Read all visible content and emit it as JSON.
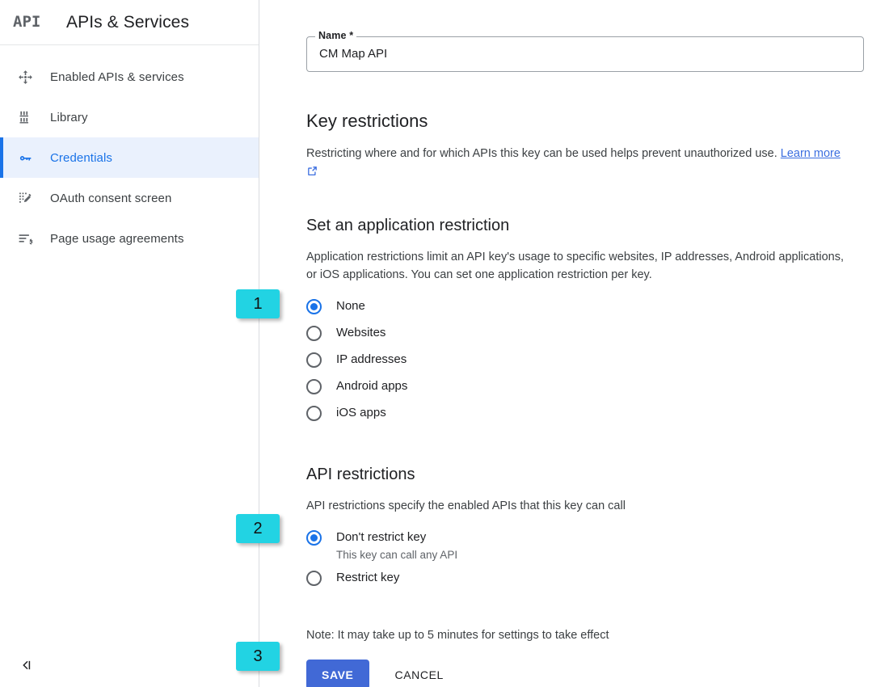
{
  "sidebar": {
    "logo_text": "API",
    "title": "APIs & Services",
    "items": [
      {
        "label": "Enabled APIs & services",
        "icon": "enabled-apis-icon",
        "active": false
      },
      {
        "label": "Library",
        "icon": "library-icon",
        "active": false
      },
      {
        "label": "Credentials",
        "icon": "key-icon",
        "active": true
      },
      {
        "label": "OAuth consent screen",
        "icon": "oauth-consent-icon",
        "active": false
      },
      {
        "label": "Page usage agreements",
        "icon": "page-usage-icon",
        "active": false
      }
    ],
    "collapse_label": "collapse-sidebar-icon"
  },
  "main": {
    "name_field": {
      "label": "Name *",
      "value": "CM Map API",
      "placeholder": ""
    },
    "key_restrictions": {
      "heading": "Key restrictions",
      "description": "Restricting where and for which APIs this key can be used helps prevent unauthorized use.",
      "link_text": "Learn more"
    },
    "application_restriction": {
      "heading": "Set an application restriction",
      "description": "Application restrictions limit an API key's usage to specific websites, IP addresses, Android applications, or iOS applications. You can set one application restriction per key.",
      "options": [
        {
          "label": "None",
          "selected": true
        },
        {
          "label": "Websites",
          "selected": false
        },
        {
          "label": "IP addresses",
          "selected": false
        },
        {
          "label": "Android apps",
          "selected": false
        },
        {
          "label": "iOS apps",
          "selected": false
        }
      ]
    },
    "api_restrictions": {
      "heading": "API restrictions",
      "description": "API restrictions specify the enabled APIs that this key can call",
      "options": [
        {
          "label": "Don't restrict key",
          "sublabel": "This key can call any API",
          "selected": true
        },
        {
          "label": "Restrict key",
          "sublabel": "",
          "selected": false
        }
      ]
    },
    "note": "Note: It may take up to 5 minutes for settings to take effect",
    "save_label": "SAVE",
    "cancel_label": "CANCEL"
  },
  "annotations": [
    {
      "number": "1",
      "target": "application-restriction-none-radio"
    },
    {
      "number": "2",
      "target": "api-restriction-dont-restrict-radio"
    },
    {
      "number": "3",
      "target": "save-button"
    }
  ],
  "colors": {
    "accent_blue": "#1a73e8",
    "save_blue": "#4169d6",
    "link_blue": "#3b6ee0",
    "badge_cyan": "#22d3e3",
    "active_nav_bg": "#eaf1fd"
  }
}
